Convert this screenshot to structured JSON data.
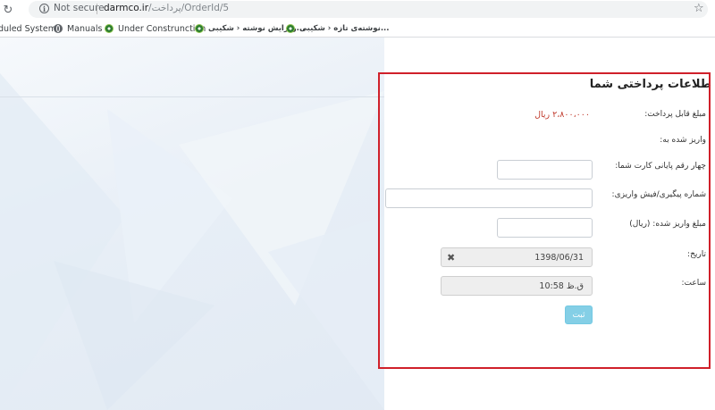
{
  "browser": {
    "security_label": "Not secure",
    "url_domain": "darmco.ir",
    "url_path": "/پرداخت/OrderId/5",
    "icons": [
      "reload-icon",
      "info-icon",
      "star-icon"
    ]
  },
  "bookmarks": [
    {
      "label": "duled System",
      "icon": "none"
    },
    {
      "label": "Manuals",
      "icon": "globe-icon"
    },
    {
      "label": "Under Construnction",
      "icon": "gear-icon"
    },
    {
      "label": "ویرایش نوشته ‹ شکیبی...",
      "icon": "gear-icon"
    },
    {
      "label": "نوشته‌ی تازه ‹ شکیبی...",
      "icon": "gear-icon"
    }
  ],
  "form": {
    "title": "طلاعات پرداختی شما",
    "amount_label": "مبلغ قابل پرداخت:",
    "amount_value": "۲،۸۰۰،۰۰۰ ریال",
    "deposited_to_label": "واریز شده به:",
    "card_last4_label": "چهار رقم پایانی کارت شما:",
    "tracking_label": "شماره پیگیری/فیش واریزی:",
    "deposit_amount_label": "مبلغ واریز شده: (ریال)",
    "date_label": "تاریخ:",
    "date_value": "1398/06/31",
    "time_label": "ساعت:",
    "time_value": "10:58 ق.ظ",
    "submit_label": "ثبت"
  },
  "colors": {
    "highlight_frame": "#d0202a",
    "amount_text": "#c0392b",
    "submit_button": "#5bc0de"
  }
}
